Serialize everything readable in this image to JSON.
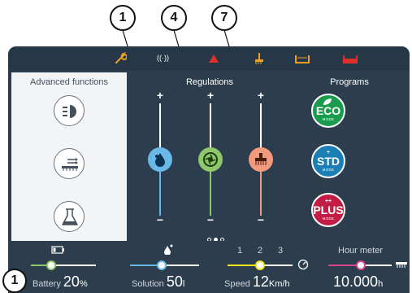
{
  "callouts": {
    "one": "1",
    "four": "4",
    "seven": "7",
    "bottom_one": "1"
  },
  "topbar": {
    "icons": [
      "wrench-icon",
      "wireless-signal-icon",
      "warning-triangle-icon",
      "brush-lift-icon",
      "solution-tank-icon",
      "recovery-tank-icon"
    ],
    "signal_text": "((·))",
    "colors": {
      "orange": "#f0a020",
      "red": "#e0302a"
    }
  },
  "advanced_functions": {
    "title": "Advanced functions",
    "buttons": [
      "headlight-icon",
      "brush-pressure-icon",
      "flask-icon"
    ]
  },
  "regulations": {
    "title": "Regulations",
    "sliders": [
      {
        "name": "water-flow",
        "plus": "+",
        "minus": "−",
        "color": "#6ab8e8",
        "level": 0.5
      },
      {
        "name": "vacuum",
        "plus": "+",
        "minus": "−",
        "color": "#8ec86a",
        "level": 0.5
      },
      {
        "name": "brush-pressure",
        "plus": "+",
        "minus": "−",
        "color": "#f29a7d",
        "level": 0.5
      }
    ],
    "page_indicator": {
      "pages": 3,
      "active": 2
    }
  },
  "programs": {
    "title": "Programs",
    "items": [
      {
        "label": "ECO",
        "sub": "MODE",
        "color": "#1a9b4d",
        "prefix": ""
      },
      {
        "label": "STD",
        "sub": "MODE",
        "color": "#1b7fb5",
        "prefix": "+"
      },
      {
        "label": "PLUS",
        "sub": "MODE",
        "color": "#c21e45",
        "prefix": "++"
      }
    ]
  },
  "status": {
    "battery": {
      "label": "Battery",
      "value": "20",
      "unit": "%",
      "level": 0.2,
      "color": "#8ec86a"
    },
    "solution": {
      "label": "Solution",
      "value": "50",
      "unit": "l",
      "level": 0.5,
      "color": "#6ab8e8"
    },
    "speed": {
      "label": "Speed",
      "value": "12",
      "unit": "Km/h",
      "gears": [
        "1",
        "2",
        "3"
      ],
      "selected_gear": 2,
      "color": "#f2e31a"
    },
    "hour_meter": {
      "label": "Hour meter",
      "value": "10.000",
      "unit": "h",
      "color": "#d8458a"
    }
  }
}
